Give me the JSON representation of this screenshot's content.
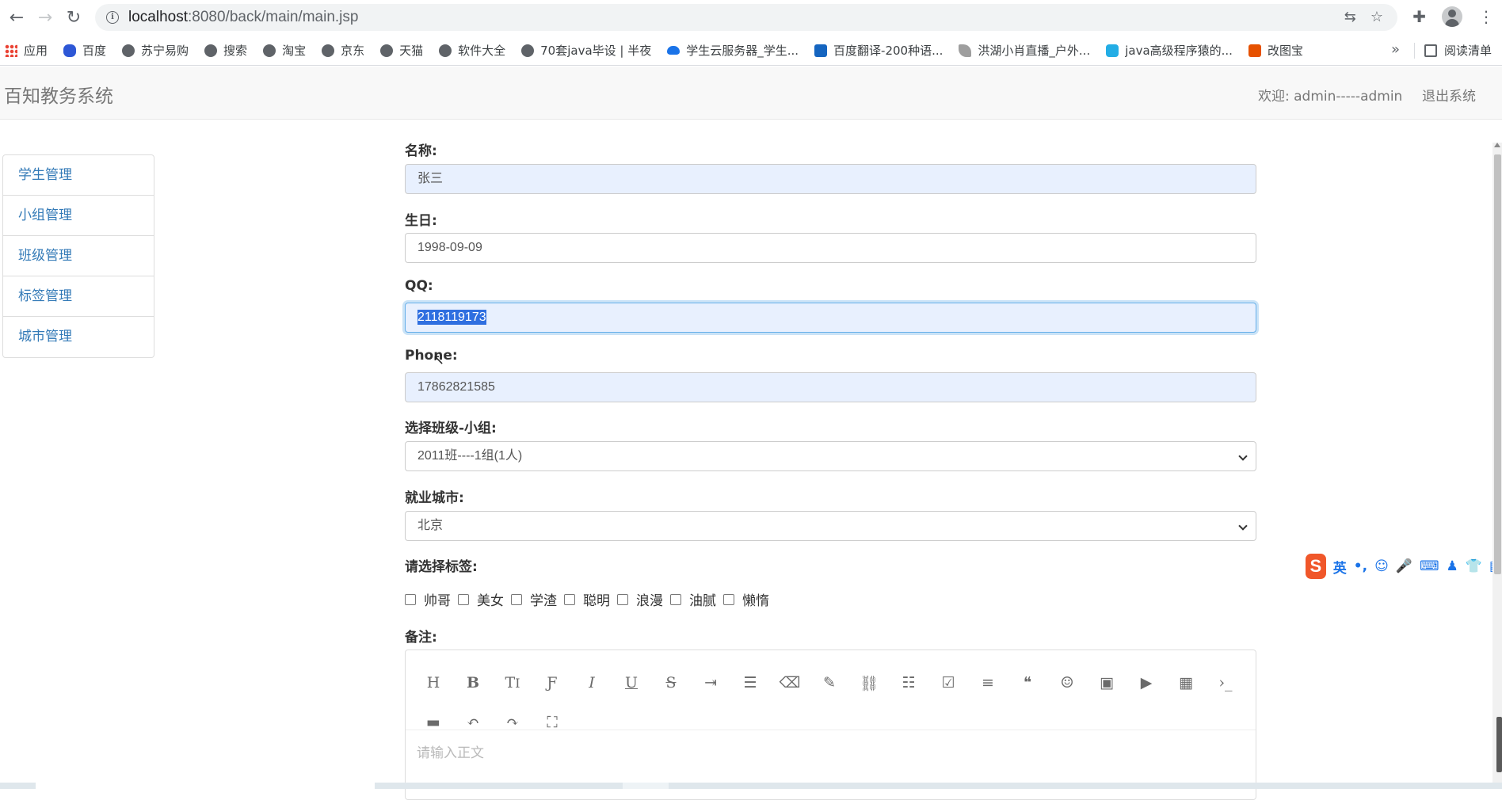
{
  "browser": {
    "url_host": "localhost",
    "url_rest": ":8080/back/main/main.jsp",
    "bookmarks": [
      {
        "label": "应用",
        "icon": "apps-grid-icon"
      },
      {
        "label": "百度",
        "icon": "baidu-paw-icon"
      },
      {
        "label": "苏宁易购",
        "icon": "globe-icon"
      },
      {
        "label": "搜索",
        "icon": "globe-icon"
      },
      {
        "label": "淘宝",
        "icon": "globe-icon"
      },
      {
        "label": "京东",
        "icon": "globe-icon"
      },
      {
        "label": "天猫",
        "icon": "globe-icon"
      },
      {
        "label": "软件大全",
        "icon": "globe-icon"
      },
      {
        "label": "70套java毕设 | 半夜",
        "icon": "globe-icon"
      },
      {
        "label": "学生云服务器_学生...",
        "icon": "cloud-icon"
      },
      {
        "label": "百度翻译-200种语...",
        "icon": "translate-icon"
      },
      {
        "label": "洪湖小肖直播_户外...",
        "icon": "feather-icon"
      },
      {
        "label": "java高级程序猿的...",
        "icon": "bilibili-tv-icon"
      },
      {
        "label": "改图宝",
        "icon": "image-icon"
      }
    ],
    "more_label": "»",
    "reading_list": "阅读清单"
  },
  "navbar": {
    "brand": "百知教务系统",
    "welcome": "欢迎: admin-----admin",
    "logout": "退出系统"
  },
  "sidebar": {
    "items": [
      {
        "label": "学生管理"
      },
      {
        "label": "小组管理"
      },
      {
        "label": "班级管理"
      },
      {
        "label": "标签管理"
      },
      {
        "label": "城市管理"
      }
    ]
  },
  "form": {
    "name_label": "名称:",
    "name_value": "张三",
    "birthday_label": "生日:",
    "birthday_value": "1998-09-09",
    "qq_label": "QQ:",
    "qq_value": "2118119173",
    "phone_label": "Phone:",
    "phone_value": "17862821585",
    "group_label": "选择班级-小组:",
    "group_value": "2011班----1组(1人)",
    "city_label": "就业城市:",
    "city_value": "北京",
    "tags_label": "请选择标签:",
    "tags": [
      "帅哥",
      "美女",
      "学渣",
      "聪明",
      "浪漫",
      "油腻",
      "懒惰"
    ],
    "remark_label": "备注:",
    "editor_placeholder": "请输入正文"
  },
  "editor_toolbar": [
    "heading-icon",
    "bold-icon",
    "font-size-icon",
    "font-family-icon",
    "italic-icon",
    "underline-icon",
    "strikethrough-icon",
    "indent-icon",
    "line-height-icon",
    "eraser-icon",
    "brush-icon",
    "link-icon",
    "bullet-list-icon",
    "checkbox-icon",
    "align-left-icon",
    "quote-icon",
    "emoji-icon",
    "image-icon",
    "video-icon",
    "table-icon",
    "code-icon",
    "hr-icon",
    "undo-icon",
    "redo-icon",
    "fullscreen-icon"
  ],
  "ime": {
    "logo": "S",
    "mode": "英"
  }
}
